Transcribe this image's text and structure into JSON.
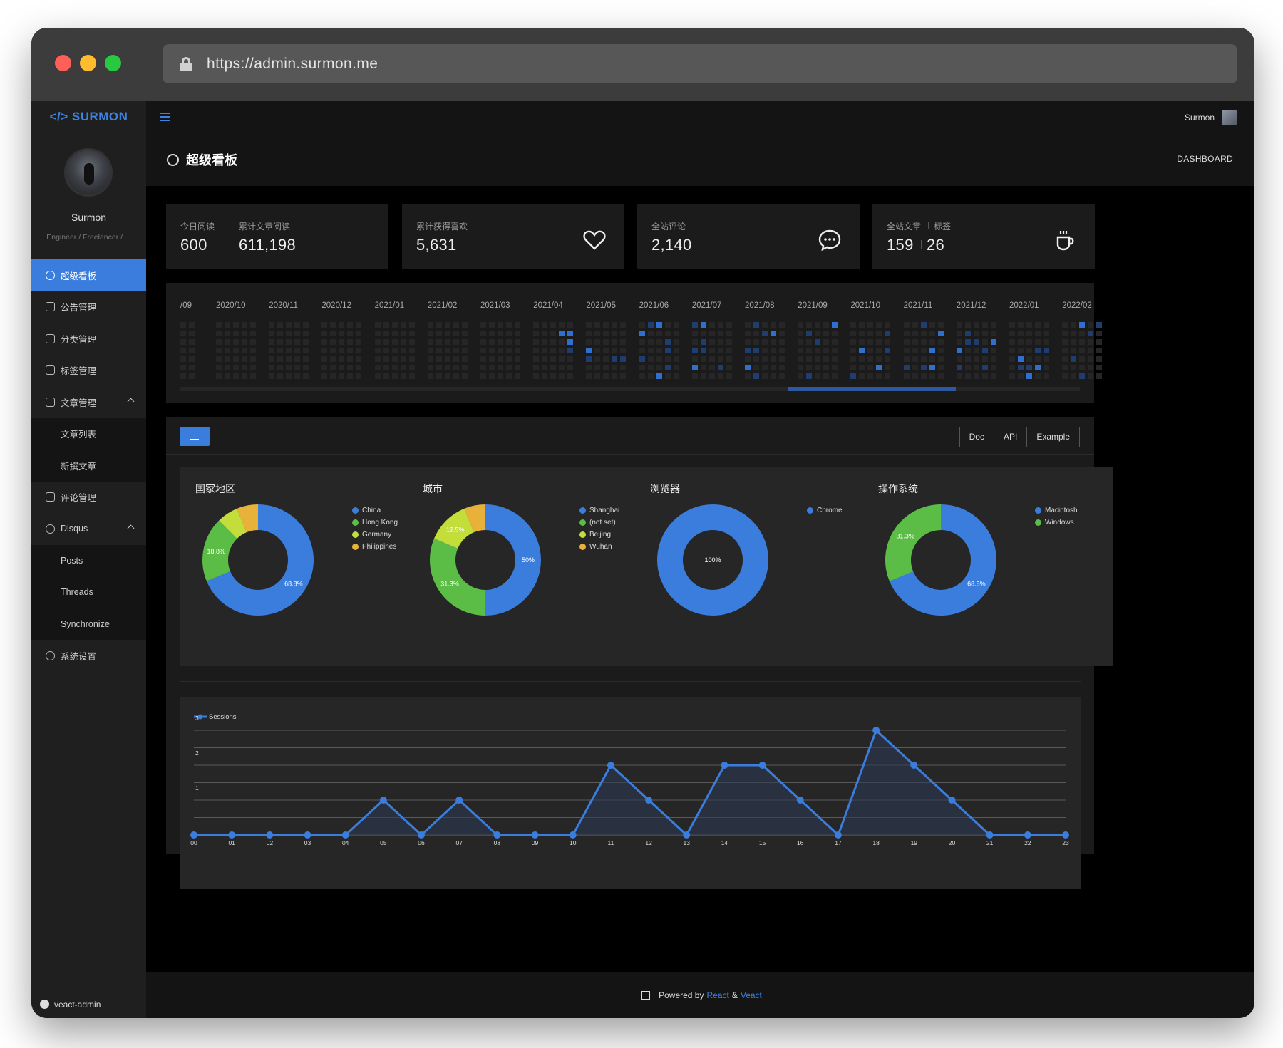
{
  "window": {
    "url": "https://admin.surmon.me"
  },
  "sidebar": {
    "logo": "</> SURMON",
    "user_name": "Surmon",
    "user_title": "Engineer / Freelancer / ...",
    "items": [
      {
        "label": "超级看板"
      },
      {
        "label": "公告管理"
      },
      {
        "label": "分类管理"
      },
      {
        "label": "标签管理"
      },
      {
        "label": "文章管理"
      },
      {
        "label": "文章列表"
      },
      {
        "label": "新撰文章"
      },
      {
        "label": "评论管理"
      },
      {
        "label": "Disqus"
      },
      {
        "label": "Posts"
      },
      {
        "label": "Threads"
      },
      {
        "label": "Synchronize"
      },
      {
        "label": "系统设置"
      }
    ],
    "footer_link": "veact-admin"
  },
  "header": {
    "user": "Surmon"
  },
  "page": {
    "title": "超级看板",
    "breadcrumb": "DASHBOARD"
  },
  "stats": {
    "today_reads": {
      "label": "今日阅读",
      "value": "600"
    },
    "total_reads": {
      "label": "累计文章阅读",
      "value": "611,198"
    },
    "likes": {
      "label": "累计获得喜欢",
      "value": "5,631"
    },
    "comments": {
      "label": "全站评论",
      "value": "2,140"
    },
    "articles": {
      "label": "全站文章",
      "value": "159"
    },
    "tags": {
      "label": "标签",
      "value": "26"
    }
  },
  "calendar": {
    "months": [
      "/09",
      "2020/10",
      "2020/11",
      "2020/12",
      "2021/01",
      "2021/02",
      "2021/03",
      "2021/04",
      "2021/05",
      "2021/06",
      "2021/07",
      "2021/08",
      "2021/09",
      "2021/10",
      "2021/11",
      "2021/12",
      "2022/01",
      "2022/02"
    ],
    "scroll_position": 0.83
  },
  "toolbar": {
    "buttons": [
      "Doc",
      "API",
      "Example"
    ]
  },
  "pies": [
    {
      "title": "国家地区",
      "legend": [
        "China",
        "Hong Kong",
        "Germany",
        "Philippines"
      ],
      "values": [
        68.8,
        18.8,
        6.2,
        6.2
      ],
      "labels": [
        "68.8%",
        "18.8%",
        "",
        ""
      ],
      "colors": [
        "#3b7ddd",
        "#5bbd45",
        "#c3dd3a",
        "#e8b23a"
      ]
    },
    {
      "title": "城市",
      "legend": [
        "Shanghai",
        "(not set)",
        "Beijing",
        "Wuhan"
      ],
      "values": [
        50,
        31.3,
        12.5,
        6.2
      ],
      "labels": [
        "50%",
        "31.3%",
        "12.5%",
        ""
      ],
      "colors": [
        "#3b7ddd",
        "#5bbd45",
        "#c3dd3a",
        "#e8b23a"
      ]
    },
    {
      "title": "浏览器",
      "legend": [
        "Chrome"
      ],
      "values": [
        100
      ],
      "labels": [
        "100%"
      ],
      "colors": [
        "#3b7ddd"
      ]
    },
    {
      "title": "操作系统",
      "legend": [
        "Macintosh",
        "Windows"
      ],
      "values": [
        68.8,
        31.3
      ],
      "labels": [
        "68.8%",
        "31.3%"
      ],
      "colors": [
        "#3b7ddd",
        "#5bbd45"
      ]
    }
  ],
  "chart_data": {
    "type": "line",
    "x": [
      "00",
      "01",
      "02",
      "03",
      "04",
      "05",
      "06",
      "07",
      "08",
      "09",
      "10",
      "11",
      "12",
      "13",
      "14",
      "15",
      "16",
      "17",
      "18",
      "19",
      "20",
      "21",
      "22",
      "23"
    ],
    "series": [
      {
        "name": "Sessions",
        "values": [
          0,
          0,
          0,
          0,
          0,
          1,
          0,
          1,
          0,
          0,
          0,
          2,
          1,
          0,
          2,
          2,
          1,
          0,
          3,
          2,
          1,
          0,
          0,
          0
        ]
      }
    ],
    "ylim": [
      0,
      3
    ],
    "yticks": [
      "1",
      "2",
      "3"
    ],
    "grid": true,
    "legend_position": "top-left",
    "color": "#3b7ddd"
  },
  "footer": {
    "prefix": "Powered by",
    "link1": "React",
    "amp": "&",
    "link2": "Veact"
  }
}
